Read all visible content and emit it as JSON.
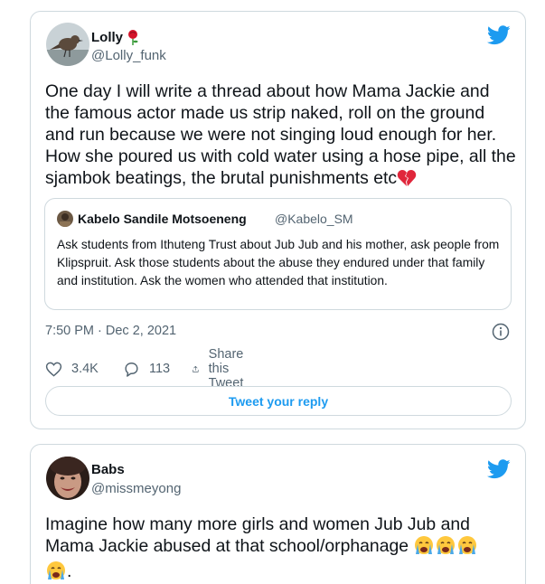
{
  "tweets": [
    {
      "display_name": "Lolly",
      "handle": "@Lolly_funk",
      "text": "One day I will write a thread about how Mama Jackie and the famous actor made us strip naked, roll on the ground and run because we were not singing loud enough for her. How she poured us with cold water using a hose pipe, all the sjambok beatings, the brutal punishments etc",
      "quoted": {
        "display_name": "Kabelo Sandile Motsoeneng",
        "handle": "@Kabelo_SM",
        "text": "Ask students from Ithuteng Trust about Jub Jub and his mother, ask people from Klipspruit. Ask those students about the abuse they endured under that family and institution. Ask the women who attended that institution."
      },
      "timestamp": "7:50 PM · Dec 2, 2021",
      "likes": "3.4K",
      "replies": "113",
      "share_label": "Share this Tweet",
      "reply_button_label": "Tweet your reply"
    },
    {
      "display_name": "Babs",
      "handle": "@missmeyong",
      "text": "Imagine how many more girls and women Jub Jub and Mama Jackie abused at that school/orphanage"
    }
  ],
  "colors": {
    "twitter_blue": "#1d9bf0",
    "secondary_text": "#536471",
    "border": "#cfd9de",
    "like_red": "#f91880"
  },
  "icons": [
    "rose-emoji",
    "broken-heart-emoji",
    "crying-face-emoji",
    "twitter-bird-icon",
    "heart-icon",
    "reply-icon",
    "share-icon",
    "info-icon"
  ]
}
